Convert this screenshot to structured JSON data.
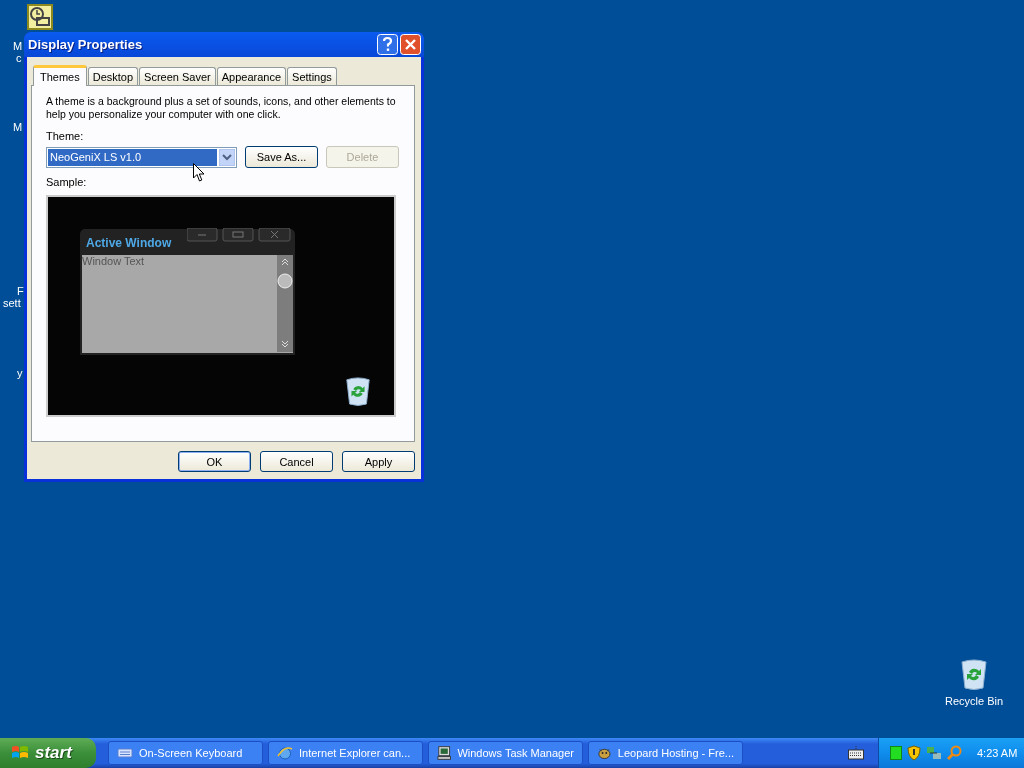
{
  "desktop": {
    "cut_labels": [
      "M",
      "c",
      "M",
      "F",
      "sett",
      "y"
    ],
    "icons": [
      {
        "label": "Recycle Bin"
      }
    ]
  },
  "window": {
    "title": "Display Properties"
  },
  "tabs": [
    {
      "label": "Themes",
      "selected": true
    },
    {
      "label": "Desktop",
      "selected": false
    },
    {
      "label": "Screen Saver",
      "selected": false
    },
    {
      "label": "Appearance",
      "selected": false
    },
    {
      "label": "Settings",
      "selected": false
    }
  ],
  "description": "A theme is a background plus a set of sounds, icons, and other elements to help you personalize your computer with one click.",
  "theme_label": "Theme:",
  "theme_select": {
    "value": "NeoGeniX LS v1.0"
  },
  "theme_buttons": [
    {
      "label": "Save As...",
      "disabled": false
    },
    {
      "label": "Delete",
      "disabled": true
    }
  ],
  "sample_label": "Sample:",
  "sample": {
    "window_title": "Active Window",
    "window_text": "Window Text"
  },
  "dialog_buttons": [
    {
      "label": "OK",
      "default": true
    },
    {
      "label": "Cancel",
      "default": false
    },
    {
      "label": "Apply",
      "default": false
    }
  ],
  "taskbar": {
    "start": "start",
    "tasks": [
      {
        "kind": "keyboard",
        "label": "On-Screen Keyboard"
      },
      {
        "kind": "browser",
        "label": "Internet Explorer can..."
      },
      {
        "kind": "monitor",
        "label": "Windows Task Manager"
      },
      {
        "kind": "animal",
        "label": "Leopard Hosting - Fre..."
      }
    ],
    "clock": "4:23 AM"
  }
}
